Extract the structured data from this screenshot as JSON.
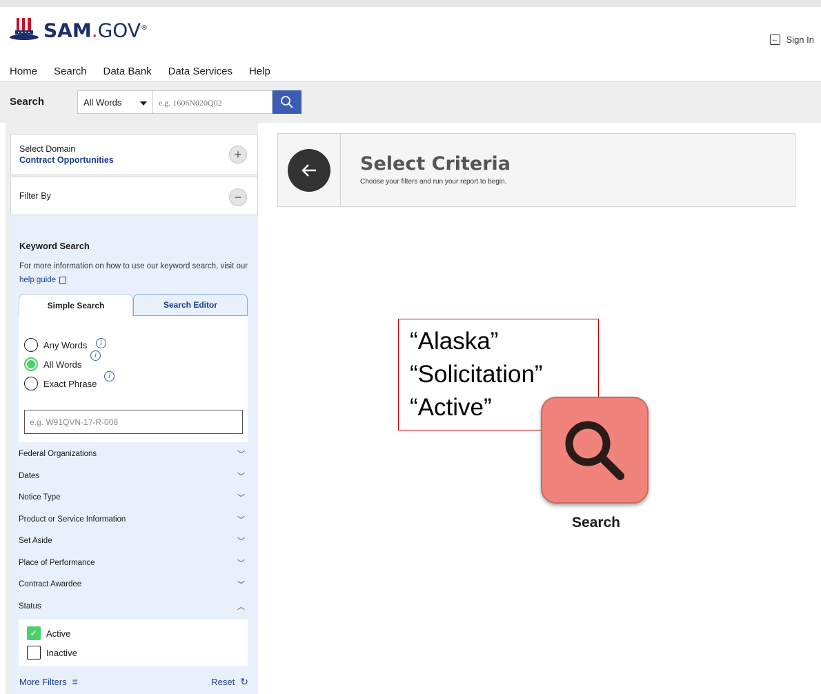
{
  "header": {
    "logo_text_sam": "SAM",
    "logo_text_dot": ".",
    "logo_text_gov": "GOV",
    "logo_text_reg": "®",
    "signin_label": "Sign In"
  },
  "nav": {
    "items": [
      {
        "label": "Home"
      },
      {
        "label": "Search",
        "active": true
      },
      {
        "label": "Data Bank"
      },
      {
        "label": "Data Services"
      },
      {
        "label": "Help"
      }
    ]
  },
  "searchbar": {
    "label": "Search",
    "mode_selected": "All Words",
    "placeholder": "e.g. 1606N020Q02"
  },
  "sidebar": {
    "domain_title": "Select Domain",
    "domain_value": "Contract Opportunities",
    "filter_by": "Filter By",
    "keyword_title": "Keyword Search",
    "keyword_desc": "For more information on how to use our keyword search, visit our",
    "help_link": "help guide",
    "tabs": {
      "simple": "Simple Search",
      "editor": "Search Editor"
    },
    "radios": [
      {
        "label": "Any Words",
        "checked": false
      },
      {
        "label": "All Words",
        "checked": true
      },
      {
        "label": "Exact Phrase",
        "checked": false
      }
    ],
    "keyword_placeholder": "e.g. W91QVN-17-R-008",
    "accordions": [
      {
        "label": "Federal Organizations",
        "open": false
      },
      {
        "label": "Dates",
        "open": false
      },
      {
        "label": "Notice Type",
        "open": false
      },
      {
        "label": "Product or Service Information",
        "open": false
      },
      {
        "label": "Set Aside",
        "open": false
      },
      {
        "label": "Place of Performance",
        "open": false
      },
      {
        "label": "Contract Awardee",
        "open": false
      },
      {
        "label": "Status",
        "open": true
      }
    ],
    "status_options": [
      {
        "label": "Active",
        "checked": true
      },
      {
        "label": "Inactive",
        "checked": false
      }
    ],
    "more_filters": "More Filters",
    "reset": "Reset"
  },
  "main": {
    "criteria_title": "Select Criteria",
    "criteria_subtitle": "Choose your filters and run your report to begin."
  },
  "overlay": {
    "lines": [
      "“Alaska”",
      "“Solicitation”",
      "“Active”"
    ],
    "app_label": "Search",
    "app_color": "#f0837b"
  },
  "colors": {
    "brand_navy": "#1a2f6b",
    "accent_green": "#4cd06b",
    "search_button": "#3b5bb5",
    "annotation_border": "#c00000"
  }
}
